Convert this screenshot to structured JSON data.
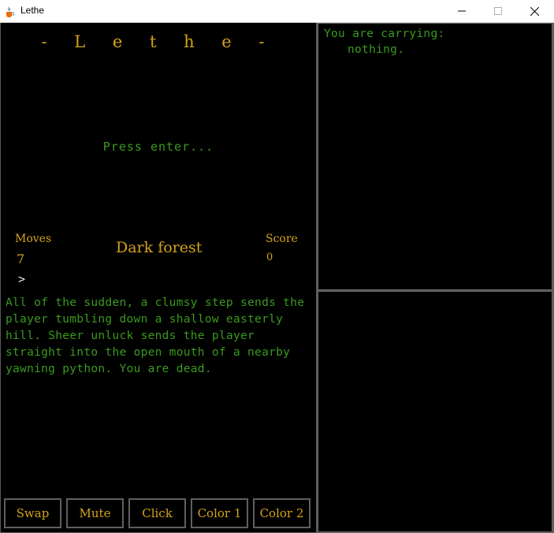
{
  "window": {
    "title": "Lethe",
    "app_icon": "java-cup-icon",
    "controls": [
      "minimize-icon",
      "maximize-icon",
      "close-icon"
    ]
  },
  "game": {
    "title": "- L e t h e -",
    "prompt": "Press enter...",
    "moves_label": "Moves",
    "moves_value": "7",
    "location": "Dark forest",
    "score_label": "Score",
    "score_value": "0",
    "caret": ">",
    "narrative": "All of the sudden, a clumsy step sends the player tumbling down a shallow easterly hill. Sheer unluck sends the player straight into the open mouth of a nearby yawning python. You are dead."
  },
  "buttons": {
    "swap": "Swap",
    "mute": "Mute",
    "click": "Click",
    "color1": "Color 1",
    "color2": "Color 2"
  },
  "inventory": {
    "heading": "You are carrying:",
    "item": "nothing."
  },
  "colors": {
    "text_green": "#3a9a1e",
    "text_gold": "#d4a31a",
    "background": "#000000",
    "border": "#5f5f5f"
  }
}
